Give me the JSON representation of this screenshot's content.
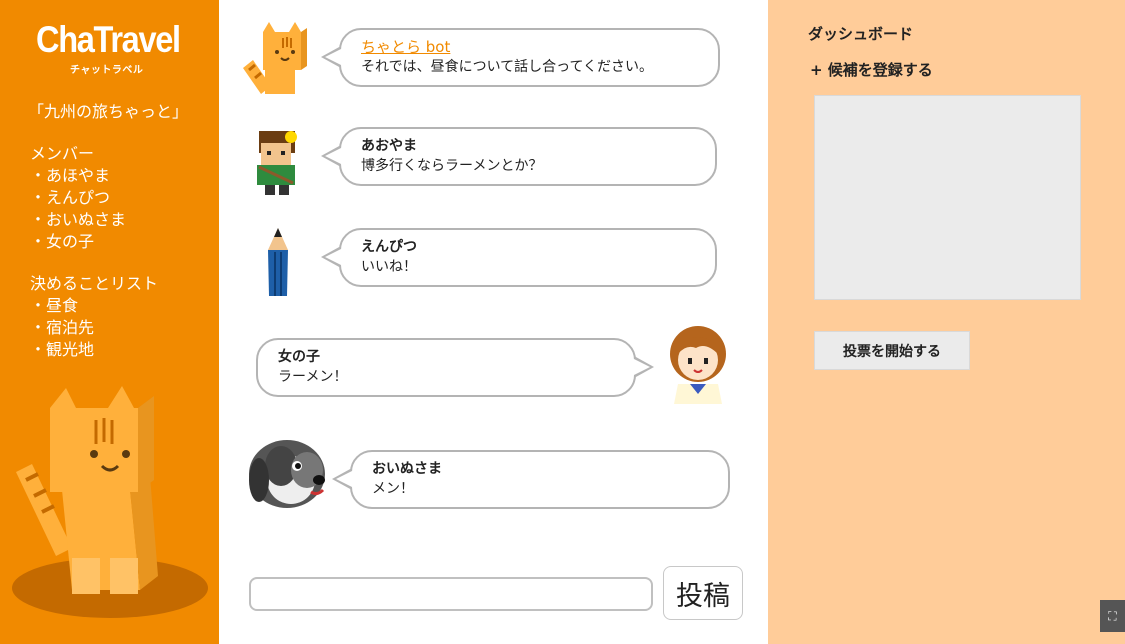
{
  "sidebar": {
    "logo": "ChaTravel",
    "logo_sub": "チャットラベル",
    "room_title": "「九州の旅ちゃっと」",
    "members_title": "メンバー",
    "members": [
      "・あほやま",
      "・えんぴつ",
      "・おいぬさま",
      "・女の子"
    ],
    "decisions_title": "決めることリスト",
    "decisions": [
      "・昼食",
      "・宿泊先",
      "・観光地"
    ]
  },
  "chat": {
    "messages": [
      {
        "sender": "ちゃとら bot",
        "text": "それでは、昼食について話し合ってください。"
      },
      {
        "sender": "あおやま",
        "text": "博多行くならラーメンとか？"
      },
      {
        "sender": "えんぴつ",
        "text": "いいね！"
      },
      {
        "sender": "女の子",
        "text": "ラーメン！"
      },
      {
        "sender": "おいぬさま",
        "text": "メン！"
      }
    ],
    "input_value": "",
    "post_label": "投稿"
  },
  "dashboard": {
    "title": "ダッシュボード",
    "add_candidate": "+ 候補を登録する",
    "vote_button": "投票を開始する"
  },
  "colors": {
    "sidebar": "#f18a00",
    "dashboard": "#ffcc99",
    "bot_link": "#f18a00"
  }
}
